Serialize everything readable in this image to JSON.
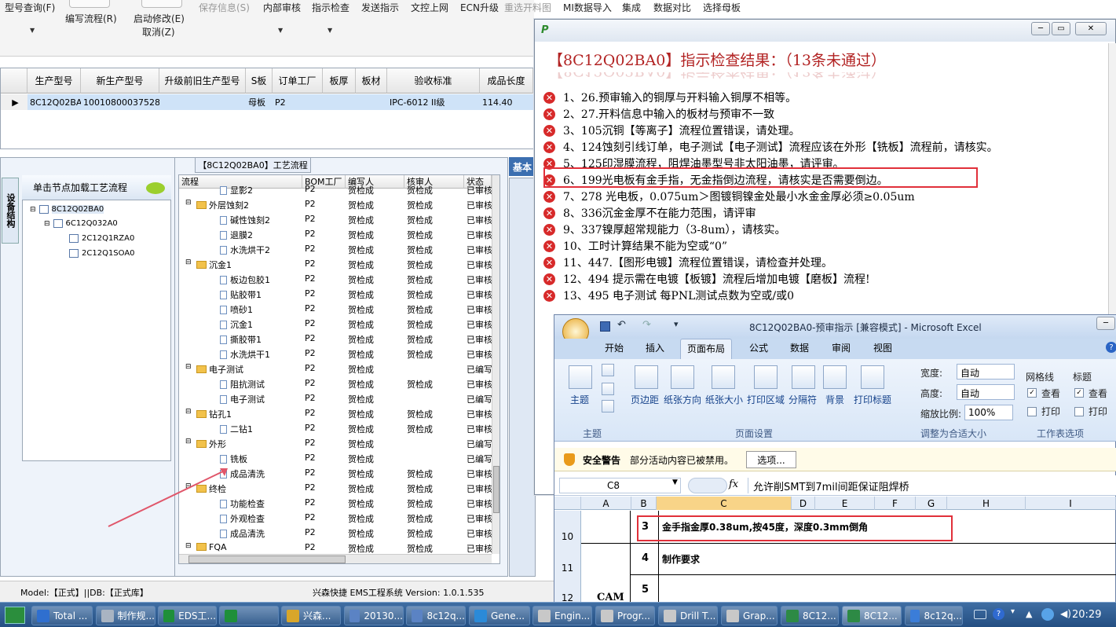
{
  "toolbar": {
    "items": [
      "型号查询(F)",
      "编写流程(R)",
      "启动修改(E)",
      "取消(Z)",
      "保存信息(S)",
      "内部审核",
      "指示检查",
      "发送指示",
      "文控上网",
      "ECN升级",
      "重选开料图",
      "MI数据导入",
      "集成",
      "数据对比",
      "选择母板"
    ]
  },
  "grid": {
    "headers": [
      "生产型号",
      "新生产型号",
      "升级前旧生产型号",
      "S板",
      "订单工厂",
      "板厚",
      "板材",
      "验收标准",
      "成品长度"
    ],
    "row": [
      "8C12Q02BA0",
      "10010800037528",
      "",
      "母板",
      "P2",
      "",
      "",
      "IPC-6012 II级",
      "114.40"
    ]
  },
  "left": {
    "vtab": "设备结构",
    "header": "单击节点加载工艺流程",
    "tree": [
      "8C12Q02BA0",
      "6C12Q032A0",
      "2C12Q1RZA0",
      "2C12Q1SOA0"
    ]
  },
  "flow": {
    "title": "【8C12Q02BA0】工艺流程",
    "headers": [
      "流程",
      "BOM工厂",
      "编写人",
      "核审人",
      "状态"
    ],
    "rows": [
      {
        "name": "显影2",
        "bom": "P2",
        "writer": "贺检成",
        "checker": "贺检成",
        "status": "已审核",
        "level": 2
      },
      {
        "name": "外层蚀刻2",
        "bom": "P2",
        "writer": "贺检成",
        "checker": "贺检成",
        "status": "已审核",
        "level": 1
      },
      {
        "name": "碱性蚀刻2",
        "bom": "P2",
        "writer": "贺检成",
        "checker": "贺检成",
        "status": "已审核",
        "level": 2
      },
      {
        "name": "退膜2",
        "bom": "P2",
        "writer": "贺检成",
        "checker": "贺检成",
        "status": "已审核",
        "level": 2
      },
      {
        "name": "水洗烘干2",
        "bom": "P2",
        "writer": "贺检成",
        "checker": "贺检成",
        "status": "已审核",
        "level": 2
      },
      {
        "name": "沉金1",
        "bom": "P2",
        "writer": "贺检成",
        "checker": "贺检成",
        "status": "已审核",
        "level": 1
      },
      {
        "name": "板边包胶1",
        "bom": "P2",
        "writer": "贺检成",
        "checker": "贺检成",
        "status": "已审核",
        "level": 2
      },
      {
        "name": "贴胶带1",
        "bom": "P2",
        "writer": "贺检成",
        "checker": "贺检成",
        "status": "已审核",
        "level": 2
      },
      {
        "name": "喷砂1",
        "bom": "P2",
        "writer": "贺检成",
        "checker": "贺检成",
        "status": "已审核",
        "level": 2
      },
      {
        "name": "沉金1",
        "bom": "P2",
        "writer": "贺检成",
        "checker": "贺检成",
        "status": "已审核",
        "level": 2
      },
      {
        "name": "撕胶带1",
        "bom": "P2",
        "writer": "贺检成",
        "checker": "贺检成",
        "status": "已审核",
        "level": 2
      },
      {
        "name": "水洗烘干1",
        "bom": "P2",
        "writer": "贺检成",
        "checker": "贺检成",
        "status": "已审核",
        "level": 2
      },
      {
        "name": "电子测试",
        "bom": "P2",
        "writer": "贺检成",
        "checker": "",
        "status": "已编写",
        "level": 1
      },
      {
        "name": "阻抗测试",
        "bom": "P2",
        "writer": "贺检成",
        "checker": "贺检成",
        "status": "已审核",
        "level": 2
      },
      {
        "name": "电子测试",
        "bom": "P2",
        "writer": "贺检成",
        "checker": "",
        "status": "已编写",
        "level": 2
      },
      {
        "name": "钻孔1",
        "bom": "P2",
        "writer": "贺检成",
        "checker": "贺检成",
        "status": "已审核",
        "level": 1
      },
      {
        "name": "二钻1",
        "bom": "P2",
        "writer": "贺检成",
        "checker": "贺检成",
        "status": "已审核",
        "level": 2
      },
      {
        "name": "外形",
        "bom": "P2",
        "writer": "贺检成",
        "checker": "",
        "status": "已编写",
        "level": 1
      },
      {
        "name": "铣板",
        "bom": "P2",
        "writer": "贺检成",
        "checker": "",
        "status": "已编写",
        "level": 2
      },
      {
        "name": "成品清洗",
        "bom": "P2",
        "writer": "贺检成",
        "checker": "贺检成",
        "status": "已审核",
        "level": 2
      },
      {
        "name": "终检",
        "bom": "P2",
        "writer": "贺检成",
        "checker": "贺检成",
        "status": "已审核",
        "level": 1
      },
      {
        "name": "功能检查",
        "bom": "P2",
        "writer": "贺检成",
        "checker": "贺检成",
        "status": "已审核",
        "level": 2
      },
      {
        "name": "外观检查",
        "bom": "P2",
        "writer": "贺检成",
        "checker": "贺检成",
        "status": "已审核",
        "level": 2
      },
      {
        "name": "成品清洗",
        "bom": "P2",
        "writer": "贺检成",
        "checker": "贺检成",
        "status": "已审核",
        "level": 2
      },
      {
        "name": "FQA",
        "bom": "P2",
        "writer": "贺检成",
        "checker": "贺检成",
        "status": "已审核",
        "level": 1
      }
    ]
  },
  "status_bar": {
    "model": "Model:【正式】||DB:【正式库】",
    "system": "兴森快捷 EMS工程系统 Version: 1.0.1.535"
  },
  "basic_tab": "基本",
  "dialog": {
    "heading": "【8C12Q02BA0】指示检查结果：（13条未通过）",
    "errors": [
      "1、26.预审输入的铜厚与开料输入铜厚不相等。",
      "2、27.开料信息中输入的板材与预审不一致",
      "3、105沉铜【等离子】流程位置错误，请处理。",
      "4、124蚀刻引线订单，电子测试【电子测试】流程应该在外形【铣板】流程前，请核实。",
      "5、125印湿膜流程，阻焊油墨型号非太阳油墨，请评审。",
      "6、199光电板有金手指，无金指倒边流程，请核实是否需要倒边。",
      "7、278 光电板，0.075um＞图镀铜镍金处最小水金金厚必须≥0.05um",
      "8、336沉金金厚不在能力范围，请评审",
      "9、337镍厚超常规能力（3-8um），请核实。",
      "10、工时计算结果不能为空或“0”",
      "11、447.【图形电镀】流程位置错误，请检查并处理。",
      "12、494 提示需在电镀【板镀】流程后增加电镀【磨板】流程!",
      "13、495 电子测试 每PNL测试点数为空或/或0"
    ]
  },
  "excel": {
    "title": "8C12Q02BA0-预审指示 [兼容模式] - Microsoft Excel",
    "tabs": [
      "开始",
      "插入",
      "页面布局",
      "公式",
      "数据",
      "审阅",
      "视图"
    ],
    "active_tab": "页面布局",
    "ribbon": {
      "themes": "主题",
      "margins": "页边距",
      "orientation": "纸张方向",
      "size": "纸张大小",
      "print_area": "打印区域",
      "breaks": "分隔符",
      "background": "背景",
      "print_titles": "打印标题",
      "width_label": "宽度:",
      "width_value": "自动",
      "height_label": "高度:",
      "height_value": "自动",
      "scale_label": "缩放比例:",
      "scale_value": "100%",
      "gridlines": "网格线",
      "headings": "标题",
      "view": "查看",
      "print": "打印",
      "group_theme": "主题",
      "group_page_setup": "页面设置",
      "group_scale": "调整为合适大小",
      "group_sheet_options": "工作表选项"
    },
    "security_warning": "安全警告",
    "security_text": "部分活动内容已被禁用。",
    "options_button": "选项...",
    "name_box": "C8",
    "formula": "允许削SMT到7mil间距保证阻焊桥",
    "columns": [
      "A",
      "B",
      "C",
      "D",
      "E",
      "F",
      "G",
      "H",
      "I"
    ],
    "rows": [
      {
        "num": "10",
        "a": "",
        "b": "3",
        "c": "金手指金厚0.38um,按45度，深度0.3mm倒角"
      },
      {
        "num": "11",
        "a": "",
        "b": "4",
        "c": "制作要求"
      },
      {
        "num": "12",
        "a": "CAM",
        "b": "5",
        "c": ""
      }
    ]
  },
  "taskbar": {
    "items": [
      "Total ...",
      "制作规...",
      "EDS工...",
      "",
      "兴森...",
      "20130...",
      "8c12q...",
      "Gene...",
      "Engin...",
      "Progr...",
      "Drill T...",
      "Grap...",
      "8C12...",
      "8C12...",
      "8c12q..."
    ],
    "clock": "20:29"
  }
}
